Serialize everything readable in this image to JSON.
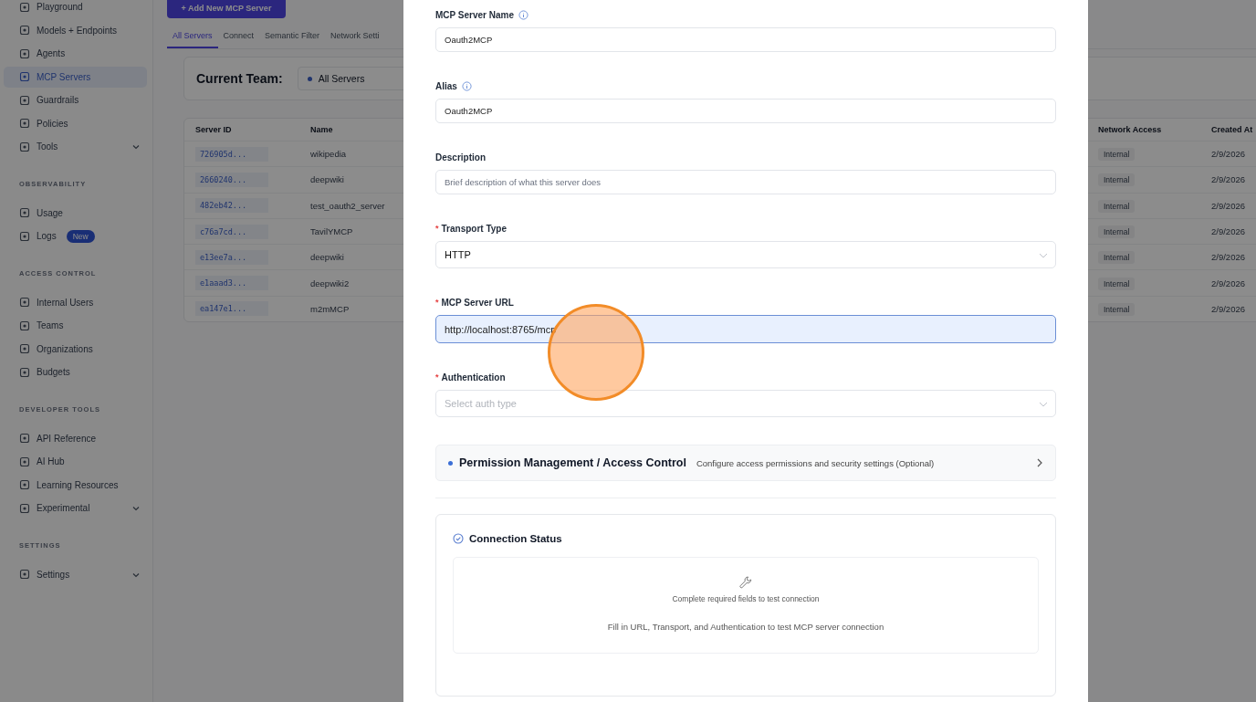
{
  "sidebar": {
    "sections": [
      {
        "items": [
          {
            "label": "Playground",
            "selected": false,
            "expandable": false
          },
          {
            "label": "Models + Endpoints",
            "selected": false,
            "expandable": false
          },
          {
            "label": "Agents",
            "selected": false,
            "expandable": false
          },
          {
            "label": "MCP Servers",
            "selected": true,
            "expandable": false
          },
          {
            "label": "Guardrails",
            "selected": false,
            "expandable": false
          },
          {
            "label": "Policies",
            "selected": false,
            "expandable": false
          },
          {
            "label": "Tools",
            "selected": false,
            "expandable": true
          }
        ]
      },
      {
        "title": "OBSERVABILITY",
        "items": [
          {
            "label": "Usage",
            "selected": false,
            "expandable": false
          },
          {
            "label": "Logs",
            "selected": false,
            "expandable": false,
            "badge": "New"
          }
        ]
      },
      {
        "title": "ACCESS CONTROL",
        "items": [
          {
            "label": "Internal Users",
            "selected": false,
            "expandable": false
          },
          {
            "label": "Teams",
            "selected": false,
            "expandable": false
          },
          {
            "label": "Organizations",
            "selected": false,
            "expandable": false
          },
          {
            "label": "Budgets",
            "selected": false,
            "expandable": false
          }
        ]
      },
      {
        "title": "DEVELOPER TOOLS",
        "items": [
          {
            "label": "API Reference",
            "selected": false,
            "expandable": false
          },
          {
            "label": "AI Hub",
            "selected": false,
            "expandable": false
          },
          {
            "label": "Learning Resources",
            "selected": false,
            "expandable": false
          },
          {
            "label": "Experimental",
            "selected": false,
            "expandable": true
          }
        ]
      },
      {
        "title": "SETTINGS",
        "items": [
          {
            "label": "Settings",
            "selected": false,
            "expandable": true
          }
        ]
      }
    ]
  },
  "page": {
    "add_button": "+ Add New MCP Server",
    "tabs": [
      {
        "label": "All Servers",
        "selected": true
      },
      {
        "label": "Connect",
        "selected": false
      },
      {
        "label": "Semantic Filter",
        "selected": false
      },
      {
        "label": "Network Setti",
        "selected": false
      }
    ],
    "team_label": "Current Team:",
    "team_select": "All Servers",
    "table": {
      "columns": [
        "Server ID",
        "Name",
        "Network Access",
        "Created At"
      ],
      "rows": [
        {
          "server_id": "726905d...",
          "name": "wikipedia",
          "network_access": "Internal",
          "created_at": "2/9/2026"
        },
        {
          "server_id": "2660240...",
          "name": "deepwiki",
          "network_access": "Internal",
          "created_at": "2/9/2026"
        },
        {
          "server_id": "482eb42...",
          "name": "test_oauth2_server",
          "network_access": "Internal",
          "created_at": "2/9/2026"
        },
        {
          "server_id": "c76a7cd...",
          "name": "TavilYMCP",
          "network_access": "Internal",
          "created_at": "2/9/2026"
        },
        {
          "server_id": "e13ee7a...",
          "name": "deepwiki",
          "network_access": "Internal",
          "created_at": "2/9/2026"
        },
        {
          "server_id": "e1aaad3...",
          "name": "deepwiki2",
          "network_access": "Internal",
          "created_at": "2/9/2026"
        },
        {
          "server_id": "ea147e1...",
          "name": "m2mMCP",
          "network_access": "Internal",
          "created_at": "2/9/2026"
        }
      ]
    }
  },
  "modal": {
    "fields": [
      {
        "label": "MCP Server Name",
        "info": true,
        "kind": "text",
        "value": "Oauth2MCP",
        "focused": false
      },
      {
        "label": "Alias",
        "info": true,
        "kind": "text",
        "value": "Oauth2MCP",
        "focused": false
      },
      {
        "label": "Description",
        "info": false,
        "kind": "text",
        "placeholder": "Brief description of what this server does",
        "focused": false
      },
      {
        "label": "Transport Type",
        "required_mark": "*",
        "info": false,
        "kind": "select",
        "value": "HTTP",
        "focused": false
      },
      {
        "label": "MCP Server URL",
        "required_mark": "*",
        "info": false,
        "kind": "text",
        "value": "http://localhost:8765/mcp",
        "focused": true
      },
      {
        "label": "Authentication",
        "required_mark": "*",
        "info": false,
        "kind": "select",
        "placeholder": "Select auth type",
        "focused": false
      }
    ],
    "permission": {
      "title": "Permission Management / Access Control",
      "description": "Configure access permissions and security settings (Optional)"
    },
    "connection": {
      "title": "Connection Status",
      "hint": "Complete required fields to test connection",
      "message": "Fill in URL, Transport, and Authentication to test MCP server connection"
    }
  }
}
